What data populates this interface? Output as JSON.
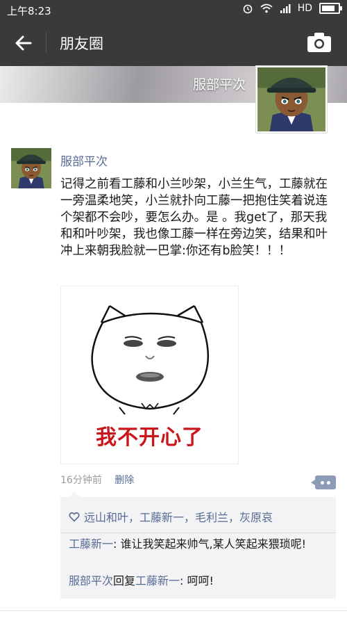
{
  "status_bar": {
    "time": "上午8:23",
    "network": "HD",
    "battery_level": 0.8
  },
  "nav": {
    "title": "朋友圈"
  },
  "cover": {
    "user_name": "服部平次"
  },
  "post": {
    "author": "服部平次",
    "content": "记得之前看工藤和小兰吵架，小兰生气，工藤就在一旁温柔地笑，小兰就扑向工藤一把抱住笑着说连个架都不会吵，要怎么办。是 。我get了，那天我和和叶吵架，我也像工藤一样在旁边笑，结果和叶冲上来朝我脸就一巴掌:你还有b脸笑！！！",
    "sticker_caption": "我不开心了",
    "time": "16分钟前",
    "delete_label": "删除",
    "likes": "远山和叶，工藤新一，毛利兰，灰原哀",
    "comments": [
      {
        "name": "工藤新一",
        "sep": ": ",
        "text": "谁让我笑起来帅气,某人笑起来猥琐呢!"
      },
      {
        "name": "服部平次",
        "reply_word": "回复",
        "target": "工藤新一",
        "sep": ": ",
        "text": "呵呵!"
      }
    ]
  }
}
